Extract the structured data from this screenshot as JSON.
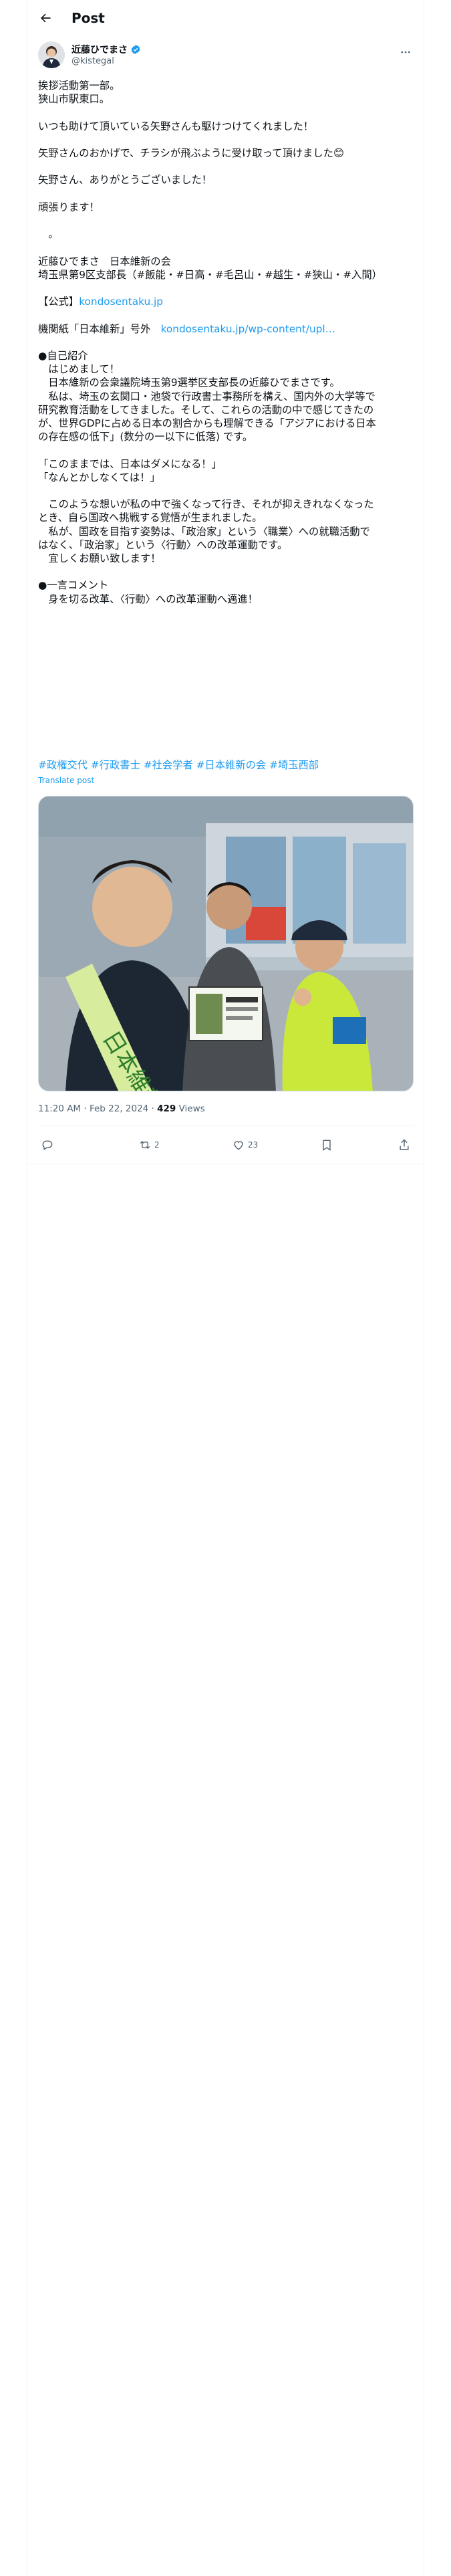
{
  "header": {
    "title": "Post"
  },
  "author": {
    "name": "近藤ひでまさ",
    "handle": "@kistegal"
  },
  "tweet_lines": [
    {
      "text": "挨拶活動第一部。"
    },
    {
      "text": "狭山市駅東口。"
    },
    {
      "text": ""
    },
    {
      "text": "いつも助けて頂いている矢野さんも駆けつけてくれました！"
    },
    {
      "text": ""
    },
    {
      "text": "矢野さんのおかげで、チラシが飛ぶように受け取って頂けました😊"
    },
    {
      "text": ""
    },
    {
      "text": "矢野さん、ありがとうございました！"
    },
    {
      "text": ""
    },
    {
      "text": "頑張ります！"
    },
    {
      "text": ""
    },
    {
      "text": "　。"
    },
    {
      "text": ""
    },
    {
      "text": "近藤ひでまさ　日本維新の会"
    },
    {
      "text": "埼玉県第9区支部長（#飯能・#日高・#毛呂山・#越生・#狭山・#入間）"
    },
    {
      "text": ""
    },
    {
      "text": "【公式】",
      "link": "kondosentaku.jp"
    },
    {
      "text": ""
    },
    {
      "text": "機関紙「日本維新」号外　",
      "link": "kondosentaku.jp/wp-content/upl…"
    },
    {
      "text": ""
    },
    {
      "text": "●自己紹介"
    },
    {
      "text": "　はじめまして！"
    },
    {
      "text": "　日本維新の会衆議院埼玉第9選挙区支部長の近藤ひでまさです。"
    },
    {
      "text": "　私は、埼玉の玄関口・池袋で行政書士事務所を構え、国内外の大学等で"
    },
    {
      "text": "研究教育活動をしてきました。そして、これらの活動の中で感じてきたの"
    },
    {
      "text": "が、世界GDPに占める日本の割合からも理解できる「アジアにおける日本"
    },
    {
      "text": "の存在感の低下」(数分の一以下に低落) です。"
    },
    {
      "text": ""
    },
    {
      "text": "「このままでは、日本はダメになる！」"
    },
    {
      "text": "「なんとかしなくては！」"
    },
    {
      "text": ""
    },
    {
      "text": "　このような想いが私の中で強くなって行き、それが抑えきれなくなった"
    },
    {
      "text": "とき、自ら国政へ挑戦する覚悟が生まれました。"
    },
    {
      "text": "　私が、国政を目指す姿勢は、「政治家」という〈職業〉への就職活動で"
    },
    {
      "text": "はなく、「政治家」という〈行動〉への改革運動です。"
    },
    {
      "text": "　宜しくお願い致します！"
    },
    {
      "text": ""
    },
    {
      "text": "●一言コメント"
    },
    {
      "text": "　身を切る改革、〈行動〉への改革運動へ邁進！"
    }
  ],
  "hashtags": "#政権交代 #行政書士 #社会学者 #日本維新の会 #埼玉西部",
  "translate_label": "Translate post",
  "meta": {
    "time": "11:20 AM · Feb 22, 2024 · ",
    "views_count": "429",
    "views_label": " Views"
  },
  "actions": {
    "reply": "",
    "repost": "2",
    "like": "23"
  },
  "colors": {
    "accent": "#1d9bf0",
    "muted": "#536471",
    "border": "#eff3f4"
  },
  "icons": [
    "back-arrow-icon",
    "verified-badge-icon",
    "more-icon",
    "reply-icon",
    "repost-icon",
    "like-icon",
    "bookmark-icon",
    "share-icon"
  ]
}
